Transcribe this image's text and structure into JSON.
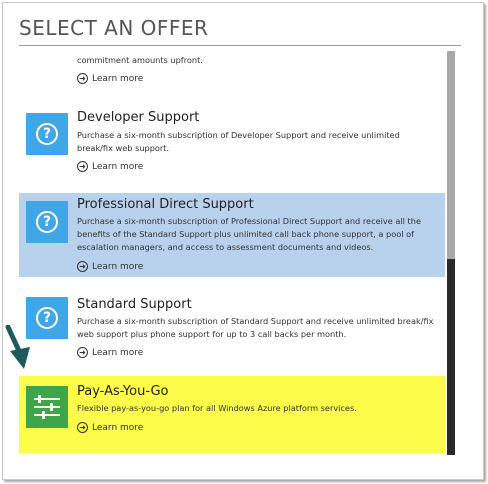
{
  "title": "SELECT AN OFFER",
  "learn_more": "Learn more",
  "partial_top": {
    "description": "commitment amounts upfront."
  },
  "offers": [
    {
      "name": "Developer Support",
      "description": "Purchase a six-month subscription of Developer Support and receive unlimited break/fix web support.",
      "icon": "question-icon"
    },
    {
      "name": "Professional Direct Support",
      "description": "Purchase a six-month subscription of Professional Direct Support and receive all the benefits of the Standard Support plus unlimited call back phone support, a pool of escalation managers, and access to assessment documents and videos.",
      "icon": "question-icon"
    },
    {
      "name": "Standard Support",
      "description": "Purchase a six-month subscription of Standard Support and receive unlimited break/fix web support plus phone support for up to 3 call backs per month.",
      "icon": "question-icon"
    },
    {
      "name": "Pay-As-You-Go",
      "description": "Flexible pay-as-you-go plan for all Windows Azure platform services.",
      "icon": "sliders-icon"
    }
  ],
  "colors": {
    "selected_bg": "#b8d2ee",
    "highlight_bg": "#fbfd4a",
    "icon_blue": "#3fa7e8",
    "icon_green": "#3fa44a",
    "annotation_arrow": "#1f5a5a"
  }
}
